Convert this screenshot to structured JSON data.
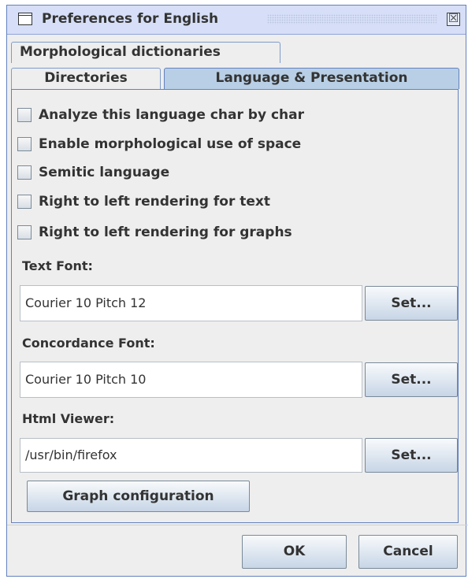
{
  "window": {
    "title": "Preferences for English",
    "close_glyph": "☒"
  },
  "tabs": {
    "morphological": "Morphological dictionaries",
    "directories": "Directories",
    "language": "Language & Presentation"
  },
  "checkboxes": [
    {
      "label": "Analyze this language char by char",
      "checked": false
    },
    {
      "label": "Enable morphological use of space",
      "checked": false
    },
    {
      "label": "Semitic language",
      "checked": false
    },
    {
      "label": "Right to left rendering for text",
      "checked": false
    },
    {
      "label": "Right to left rendering for graphs",
      "checked": false
    }
  ],
  "text_font": {
    "label": "Text Font:",
    "value": "Courier 10 Pitch  12",
    "button": "Set..."
  },
  "concordance_font": {
    "label": "Concordance Font:",
    "value": "Courier 10 Pitch  10",
    "button": "Set..."
  },
  "html_viewer": {
    "label": "Html Viewer:",
    "value": "/usr/bin/firefox",
    "button": "Set..."
  },
  "graph_config_button": "Graph configuration",
  "footer": {
    "ok": "OK",
    "cancel": "Cancel"
  },
  "colors": {
    "selected_tab": "#b8cfe5",
    "border": "#6382bf",
    "background": "#eeeeee"
  }
}
